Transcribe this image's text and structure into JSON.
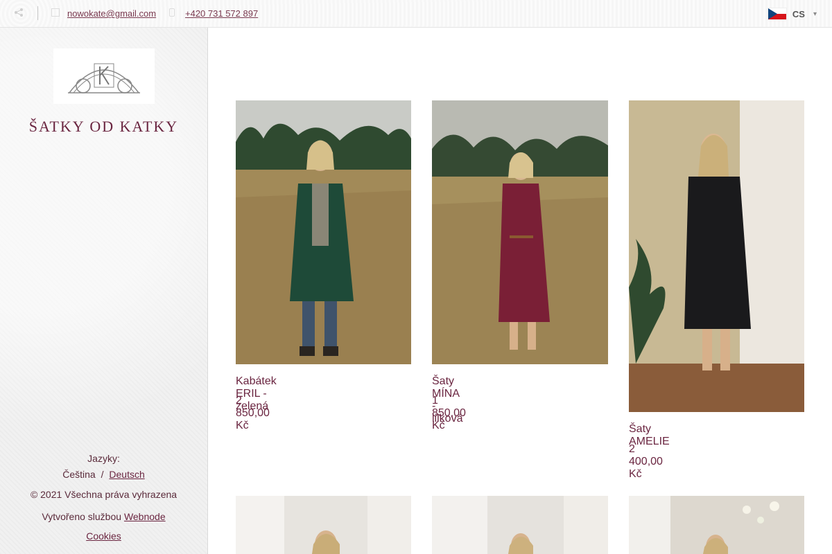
{
  "topbar": {
    "email": "nowokate@gmail.com",
    "phone": "+420 731 572 897",
    "language_code": "CS",
    "icons": [
      "share-icon",
      "mail-icon",
      "phone-icon",
      "czech-flag-icon",
      "chevron-down-icon"
    ]
  },
  "sidebar": {
    "site_title": "ŠATKY OD KATKY",
    "languages_label": "Jazyky:",
    "languages": [
      "Čeština",
      "Deutsch"
    ],
    "lang_separator": "/",
    "copyright": "© 2021 Všechna práva vyhrazena",
    "built_with_prefix": "Vytvořeno službou",
    "built_with_link": "Webnode",
    "cookies": "Cookies"
  },
  "products": [
    {
      "name": "Kabátek ERIL - zelená",
      "price": "2 850,00 Kč",
      "garment_color": "#1e4a38"
    },
    {
      "name": "Šaty MÍNA - lilková",
      "price": "1 850,00 Kč",
      "garment_color": "#7a1f36"
    },
    {
      "name": "Šaty AMELIE",
      "price": "2 400,00 Kč",
      "garment_color": "#1a1a1c"
    }
  ],
  "colors": {
    "accent": "#6a2540",
    "text": "#5a2a3a"
  }
}
